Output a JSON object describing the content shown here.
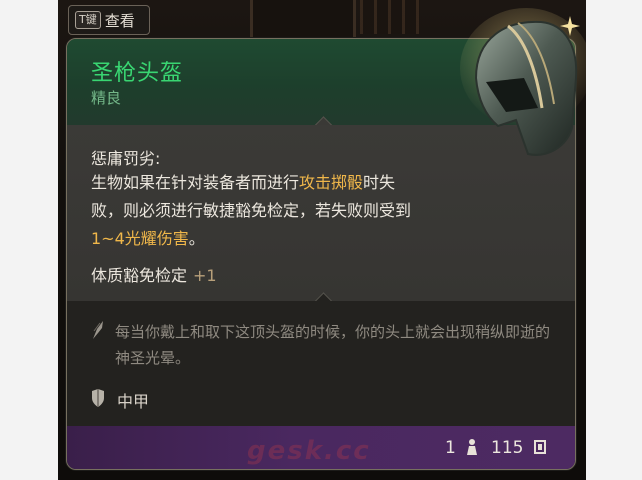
{
  "keyhint": {
    "key": "T键",
    "label": "查看"
  },
  "item": {
    "name": "圣枪头盔",
    "rarity": "精良",
    "name_color": "#39d672",
    "rarity_color": "#74b889"
  },
  "passive": {
    "title": "惩庸罚劣:",
    "desc_part1": "生物如果在针对装备者而进行",
    "desc_hl1": "攻击掷骰",
    "desc_part2": "时失败，则必须进行敏捷豁免检定，若失败则受到",
    "desc_hl2": "1~4光耀伤害",
    "desc_part3": "。",
    "highlight_color": "#f0b74a"
  },
  "stat": {
    "label": "体质豁免检定",
    "value": "+1"
  },
  "flavor": {
    "icon": "quill-icon",
    "text": "每当你戴上和取下这顶头盔的时候，你的头上就会出现稍纵即逝的神圣光晕。"
  },
  "armor": {
    "icon": "shield-icon",
    "type": "中甲"
  },
  "footer": {
    "weight": "1",
    "weight_icon": "weight-icon",
    "price": "115",
    "coin_icon": "gold-coin-icon",
    "watermark": "gesk.cc"
  }
}
